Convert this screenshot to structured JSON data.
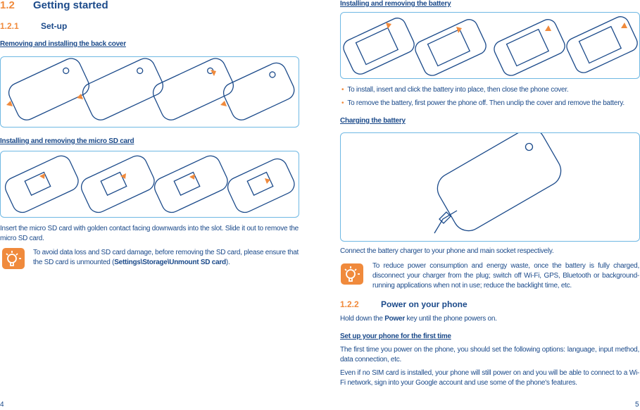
{
  "left_page": {
    "section_number": "1.2",
    "section_title": "Getting started",
    "subsection_number": "1.2.1",
    "subsection_title": "Set-up",
    "back_cover_heading": "Removing and installing the back cover",
    "sd_heading": "Installing and removing the micro SD card",
    "sd_paragraph": "Insert the micro SD card with golden contact facing downwards into the slot. Slide it out to remove the micro SD card.",
    "tip_text_before": "To avoid data loss and SD card damage, before removing the SD card, please ensure that the SD card is unmounted (",
    "tip_text_bold": "Settings\\Storage\\Unmount SD card",
    "tip_text_after": ").",
    "page_number": "4"
  },
  "right_page": {
    "battery_heading": "Installing and removing the battery",
    "bullets": [
      "To install, insert and click the battery into place, then close the phone cover.",
      "To remove the battery, first power the phone off. Then unclip the cover and remove the battery."
    ],
    "charging_heading": "Charging the battery",
    "charging_paragraph": "Connect the battery charger to your phone and main socket respectively.",
    "tip_text": "To reduce power consumption and energy waste, once the battery is fully charged, disconnect your charger from the plug; switch off Wi-Fi, GPS, Bluetooth or background-running applications when not in use; reduce the backlight time, etc.",
    "subsection_number": "1.2.2",
    "subsection_title": "Power on your phone",
    "power_text_before": "Hold down the ",
    "power_text_bold": "Power",
    "power_text_after": " key until the phone powers on.",
    "setup_heading": "Set up your phone for the first time",
    "setup_paragraph_1": "The first time you power on the phone, you should set the following options: language, input method, data connection, etc.",
    "setup_paragraph_2": "Even if no SIM card is installed, your phone will still power on and you will be able to connect to a Wi-Fi network, sign into your Google account and use some of the phone's features.",
    "page_number": "5"
  },
  "colors": {
    "text": "#1b4a8a",
    "accent": "#f08a3c",
    "frame": "#6fb8e3"
  },
  "icons": [
    "lightbulb-tip-icon",
    "bullet-dot-icon"
  ]
}
